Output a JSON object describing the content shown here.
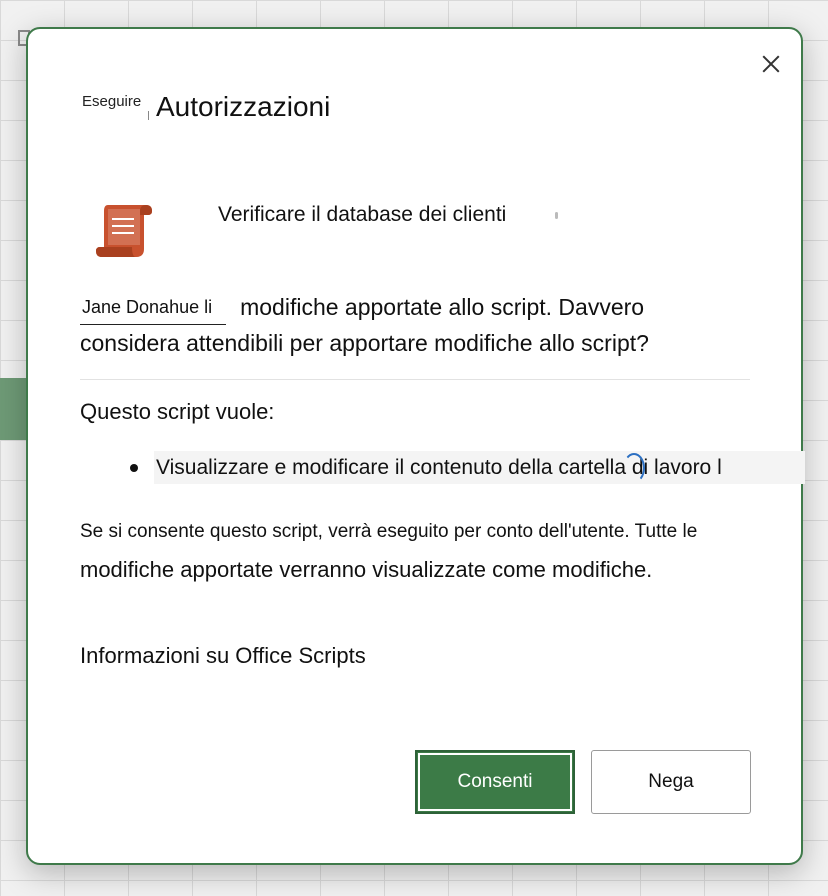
{
  "dialog": {
    "title_prefix": "Eseguire",
    "title": "Autorizzazioni",
    "close_label": "×"
  },
  "script": {
    "icon": "script-scroll-icon",
    "name": "Verificare il database dei clienti"
  },
  "trust": {
    "author": "Jane Donahue li",
    "line1_rest": "modifiche apportate allo script. Davvero",
    "line2": "considera attendibili per apportare modifiche allo script?"
  },
  "permissions": {
    "heading": "Questo script vuole:",
    "items": [
      "Visualizzare e modificare il contenuto della cartella di lavoro l"
    ]
  },
  "consent": {
    "line1": "Se si consente questo script, verrà eseguito per conto dell'utente. Tutte le",
    "line2": "modifiche apportate verranno visualizzate come modifiche."
  },
  "info_link": "Informazioni su Office Scripts",
  "buttons": {
    "allow": "Consenti",
    "deny": "Nega"
  },
  "colors": {
    "accent": "#3c7b47",
    "icon": "#c8512e",
    "spinner": "#2b6fc2"
  }
}
